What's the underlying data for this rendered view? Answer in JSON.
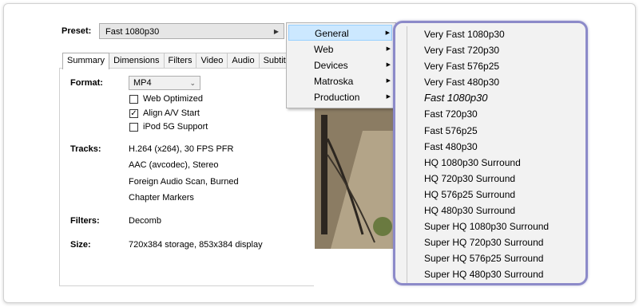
{
  "preset": {
    "label": "Preset:",
    "value": "Fast 1080p30"
  },
  "tabs": [
    "Summary",
    "Dimensions",
    "Filters",
    "Video",
    "Audio",
    "Subtitle"
  ],
  "summary": {
    "format_label": "Format:",
    "format_value": "MP4",
    "checkboxes": [
      {
        "label": "Web Optimized",
        "checked": false
      },
      {
        "label": "Align A/V Start",
        "checked": true
      },
      {
        "label": "iPod 5G Support",
        "checked": false
      }
    ],
    "tracks_label": "Tracks:",
    "tracks": [
      "H.264 (x264), 30 FPS PFR",
      "AAC (avcodec), Stereo",
      "Foreign Audio Scan, Burned",
      "Chapter Markers"
    ],
    "filters_label": "Filters:",
    "filters_value": "Decomb",
    "size_label": "Size:",
    "size_value": "720x384 storage, 853x384 display"
  },
  "menu_categories": [
    {
      "label": "General",
      "selected": true
    },
    {
      "label": "Web",
      "selected": false
    },
    {
      "label": "Devices",
      "selected": false
    },
    {
      "label": "Matroska",
      "selected": false
    },
    {
      "label": "Production",
      "selected": false
    }
  ],
  "general_presets": [
    {
      "label": "Very Fast 1080p30",
      "default": false
    },
    {
      "label": "Very Fast 720p30",
      "default": false
    },
    {
      "label": "Very Fast 576p25",
      "default": false
    },
    {
      "label": "Very Fast 480p30",
      "default": false
    },
    {
      "label": "Fast 1080p30",
      "default": true
    },
    {
      "label": "Fast 720p30",
      "default": false
    },
    {
      "label": "Fast 576p25",
      "default": false
    },
    {
      "label": "Fast 480p30",
      "default": false
    },
    {
      "label": "HQ 1080p30 Surround",
      "default": false
    },
    {
      "label": "HQ 720p30 Surround",
      "default": false
    },
    {
      "label": "HQ 576p25 Surround",
      "default": false
    },
    {
      "label": "HQ 480p30 Surround",
      "default": false
    },
    {
      "label": "Super HQ 1080p30 Surround",
      "default": false
    },
    {
      "label": "Super HQ 720p30 Surround",
      "default": false
    },
    {
      "label": "Super HQ 576p25 Surround",
      "default": false
    },
    {
      "label": "Super HQ 480p30 Surround",
      "default": false
    }
  ],
  "colors": {
    "highlight": "#cce8ff",
    "callout_border": "#8c8ac9"
  }
}
